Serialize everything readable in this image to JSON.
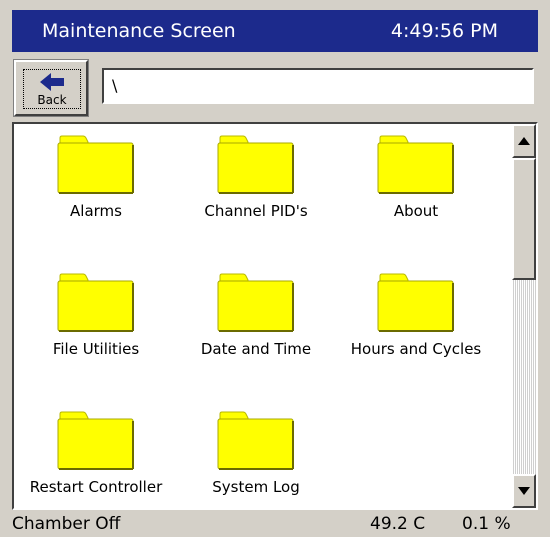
{
  "header": {
    "title": "Maintenance Screen",
    "time": "4:49:56 PM"
  },
  "toolbar": {
    "back_label": "Back",
    "path": "\\"
  },
  "folders": [
    {
      "label": "Alarms",
      "icon": "folder-icon"
    },
    {
      "label": "Channel PID's",
      "icon": "folder-icon"
    },
    {
      "label": "About",
      "icon": "folder-icon"
    },
    {
      "label": "File Utilities",
      "icon": "folder-icon"
    },
    {
      "label": "Date and Time",
      "icon": "folder-icon"
    },
    {
      "label": "Hours and Cycles",
      "icon": "folder-icon"
    },
    {
      "label": "Restart Controller",
      "icon": "folder-icon"
    },
    {
      "label": "System Log",
      "icon": "folder-icon"
    }
  ],
  "status": {
    "state": "Chamber Off",
    "temperature": "49.2 C",
    "output": "0.1 %"
  },
  "colors": {
    "title_bar": "#1c2a8c",
    "folder": "#ffff00",
    "window": "#d4d0c8"
  }
}
